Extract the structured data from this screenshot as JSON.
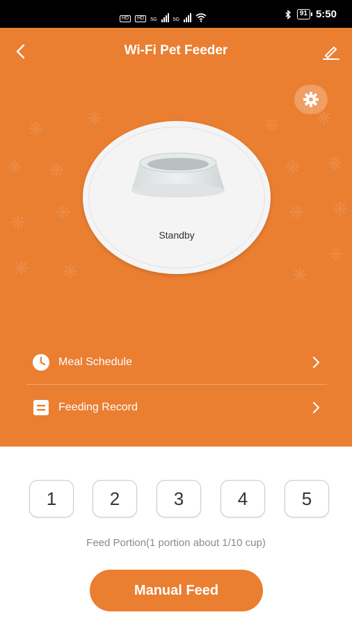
{
  "status_bar": {
    "left_chips": [
      "HD",
      "HD"
    ],
    "network_a": "5G",
    "network_b": "5G",
    "battery": "91",
    "time": "5:50"
  },
  "header": {
    "title": "Wi-Fi Pet Feeder"
  },
  "device": {
    "status": "Standby"
  },
  "menu": [
    {
      "label": "Meal Schedule",
      "icon": "clock-icon"
    },
    {
      "label": "Feeding Record",
      "icon": "list-icon"
    }
  ],
  "portions": [
    "1",
    "2",
    "3",
    "4",
    "5"
  ],
  "portion_note": "Feed Portion(1 portion about 1/10 cup)",
  "manual_feed_label": "Manual Feed",
  "colors": {
    "accent": "#ea7e31",
    "background": "#ffffff",
    "status_bar": "#000000"
  }
}
